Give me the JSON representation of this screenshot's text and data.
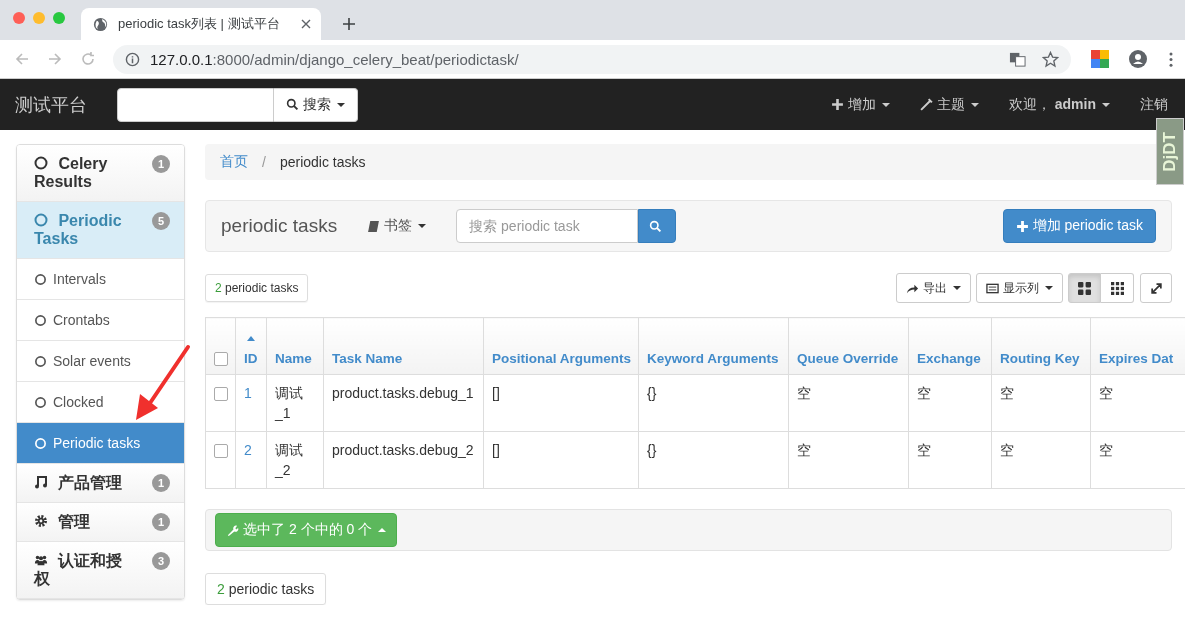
{
  "browser": {
    "tab_title": "periodic task列表 | 测试平台",
    "url_host": "127.0.0.1",
    "url_path": ":8000/admin/django_celery_beat/periodictask/"
  },
  "navbar": {
    "brand": "测试平台",
    "search_button": "搜索",
    "menus": [
      {
        "kind": "add",
        "label": "增加"
      },
      {
        "kind": "theme",
        "label": "主题"
      },
      {
        "kind": "user",
        "label": "欢迎，**admin**"
      }
    ],
    "logout": "注销"
  },
  "debug_toolbar": {
    "label": "DjDT"
  },
  "sidebar": {
    "groups": [
      {
        "label": "Celery Results",
        "kind": "circle",
        "badge": "1",
        "selected": false
      },
      {
        "label": "Periodic Tasks",
        "kind": "circle",
        "badge": "5",
        "selected": true,
        "children": [
          {
            "label": "Intervals",
            "selected": false
          },
          {
            "label": "Crontabs",
            "selected": false
          },
          {
            "label": "Solar events",
            "selected": false
          },
          {
            "label": "Clocked",
            "selected": false
          },
          {
            "label": "Periodic tasks",
            "selected": true
          }
        ]
      },
      {
        "label": "产品管理",
        "kind": "music",
        "badge": "1",
        "selected": false
      },
      {
        "label": "管理",
        "kind": "gear",
        "badge": "1",
        "selected": false
      },
      {
        "label": "认证和授权",
        "kind": "users",
        "badge": "3",
        "selected": false
      }
    ]
  },
  "breadcrumb": {
    "home": "首页",
    "separator": "/",
    "current": "periodic tasks"
  },
  "toolbar": {
    "title": "periodic tasks",
    "bookmarks": "书签",
    "search": {
      "placeholder": "搜索 periodic task"
    },
    "add_button": "增加 periodic task"
  },
  "summary": {
    "count": "2",
    "label": "periodic tasks"
  },
  "tools": {
    "export": "导出",
    "columns": "显示列",
    "views": [
      {
        "kind": "cards",
        "selected": true
      },
      {
        "kind": "grid",
        "selected": false
      }
    ]
  },
  "table": {
    "select_all": {
      "checked": false
    },
    "columns": [
      {
        "label": "ID",
        "sorted": true
      },
      {
        "label": "Name",
        "sorted": false
      },
      {
        "label": "Task Name",
        "sorted": false
      },
      {
        "label": "Positional Arguments",
        "sorted": false
      },
      {
        "label": "Keyword Arguments",
        "sorted": false
      },
      {
        "label": "Queue Override",
        "sorted": false
      },
      {
        "label": "Exchange",
        "sorted": false
      },
      {
        "label": "Routing Key",
        "sorted": false
      },
      {
        "label": "Expires Dat",
        "sorted": false
      }
    ],
    "rows": [
      {
        "checked": false,
        "cells": [
          "1",
          "调试_1",
          "product.tasks.debug_1",
          "[]",
          "{}",
          "空",
          "空",
          "空",
          "空"
        ]
      },
      {
        "checked": false,
        "cells": [
          "2",
          "调试_2",
          "product.tasks.debug_2",
          "[]",
          "{}",
          "空",
          "空",
          "空",
          "空"
        ]
      }
    ]
  },
  "actions": {
    "label": "选中了 2 个中的 0 个"
  },
  "footer_count": {
    "count": "2",
    "label": "periodic tasks"
  }
}
